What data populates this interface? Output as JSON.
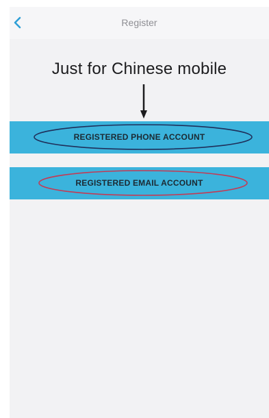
{
  "header": {
    "title": "Register",
    "back_icon": "chevron-left-icon"
  },
  "annotation": {
    "text": "Just for Chinese mobile",
    "arrow_icon": "down-arrow-icon"
  },
  "buttons": {
    "phone_label": "REGISTERED PHONE ACCOUNT",
    "email_label": "REGISTERED EMAIL ACCOUNT"
  },
  "colors": {
    "accent": "#2e9fd6",
    "button_bg": "#3bb3dc",
    "background": "#f2f2f4",
    "phone_circle": "#1f2f5a",
    "email_circle": "#c43a54"
  }
}
